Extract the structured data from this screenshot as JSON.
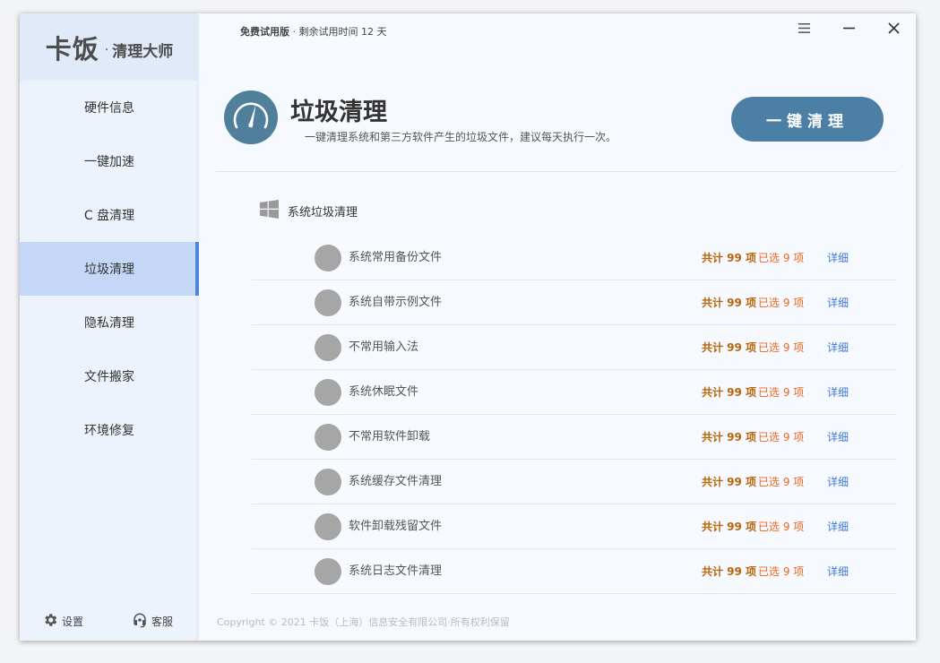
{
  "sidebar": {
    "brand": "卡饭",
    "brand_sep": "·",
    "brand_sub": "清理大师",
    "items": [
      {
        "label": "硬件信息"
      },
      {
        "label": "一键加速"
      },
      {
        "label": "C 盘清理"
      },
      {
        "label": "垃圾清理"
      },
      {
        "label": "隐私清理"
      },
      {
        "label": "文件搬家"
      },
      {
        "label": "环境修复"
      }
    ],
    "active_index": 3,
    "footer": {
      "settings_label": "设置",
      "settings_icon": "gear-icon",
      "service_label": "客服",
      "service_icon": "headset-icon"
    }
  },
  "header": {
    "trial_edition": "免费试用版",
    "trial_sep": "·",
    "trial_remaining": "剩余试用时间 12 天",
    "window_controls": [
      "menu-icon",
      "minimize-icon",
      "close-icon"
    ]
  },
  "page": {
    "icon": "gauge-icon",
    "icon_color": "#4f7f9a",
    "title": "垃圾清理",
    "description": "一键清理系统和第三方软件产生的垃圾文件，建议每天执行一次。",
    "clean_button_label": "一键清理",
    "accent_color": "#4c7fa5"
  },
  "section": {
    "icon": "windows-logo-icon",
    "title": "系统垃圾清理"
  },
  "items": [
    {
      "name": "系统常用备份文件",
      "total": "共计 99 项",
      "selected": "已选 9 项",
      "detail": "详细"
    },
    {
      "name": "系统自带示例文件",
      "total": "共计 99 项",
      "selected": "已选 9 项",
      "detail": "详细"
    },
    {
      "name": "不常用输入法",
      "total": "共计 99 项",
      "selected": "已选 9 项",
      "detail": "详细"
    },
    {
      "name": "系统休眠文件",
      "total": "共计 99 项",
      "selected": "已选 9 项",
      "detail": "详细"
    },
    {
      "name": "不常用软件卸载",
      "total": "共计 99 项",
      "selected": "已选 9 项",
      "detail": "详细"
    },
    {
      "name": "系统缓存文件清理",
      "total": "共计 99 项",
      "selected": "已选 9 项",
      "detail": "详细"
    },
    {
      "name": "软件卸载残留文件",
      "total": "共计 99 项",
      "selected": "已选 9 项",
      "detail": "详细"
    },
    {
      "name": "系统日志文件清理",
      "total": "共计 99 项",
      "selected": "已选 9 项",
      "detail": "详细"
    }
  ],
  "footer": {
    "copyright": "Copyright © 2021 卡饭（上海）信息安全有限公司·所有权利保留"
  }
}
